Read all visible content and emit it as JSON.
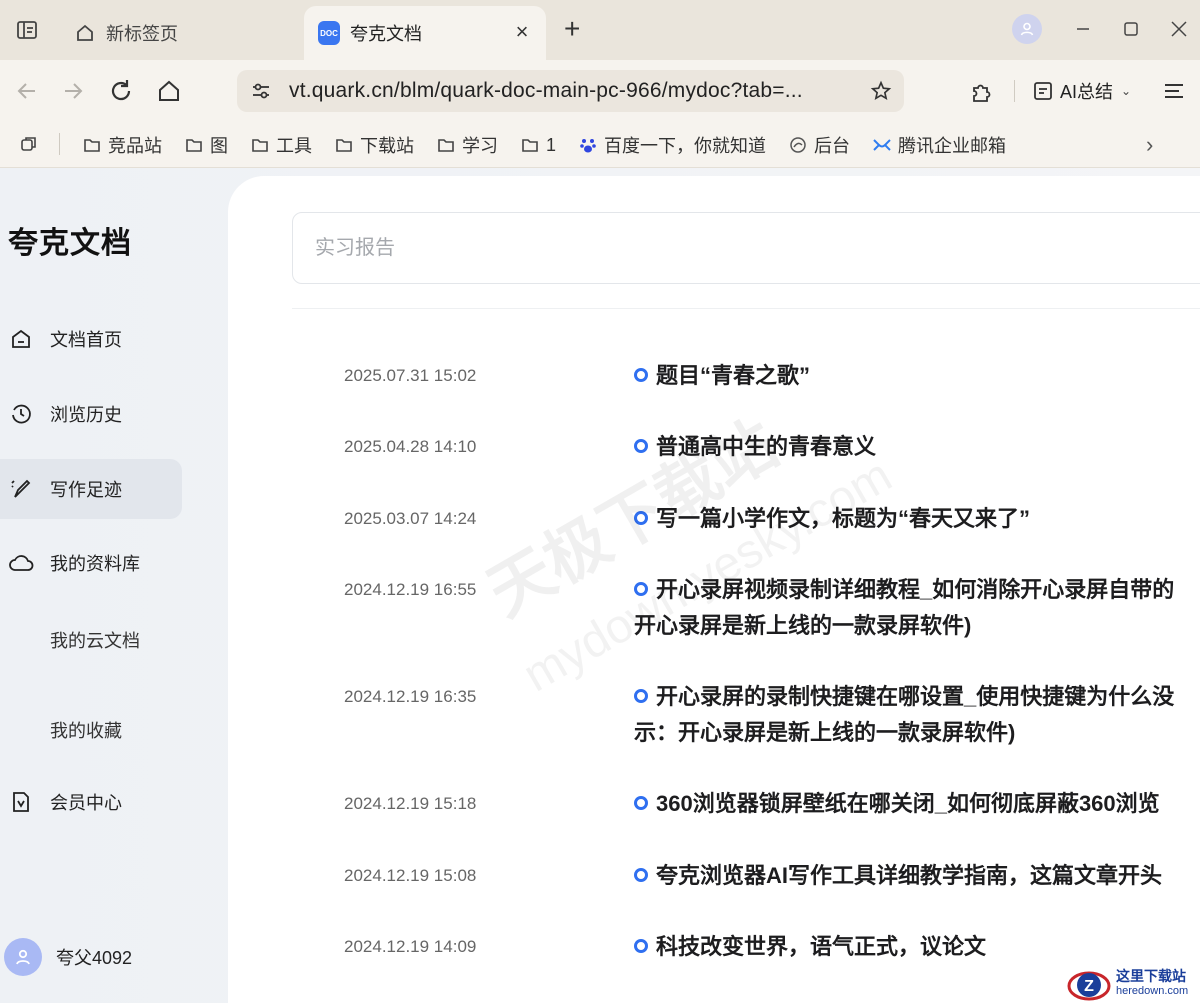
{
  "browser": {
    "tabs": [
      {
        "label": "新标签页",
        "active": false
      },
      {
        "label": "夸克文档",
        "active": true
      }
    ],
    "new_tab": "+",
    "close_tab": "×",
    "url": "vt.quark.cn/blm/quark-doc-main-pc-966/mydoc?tab=...",
    "ai_summary": "AI总结",
    "bookmarks": [
      {
        "label": "竞品站",
        "icon": "folder-icon"
      },
      {
        "label": "图",
        "icon": "folder-icon"
      },
      {
        "label": "工具",
        "icon": "folder-icon"
      },
      {
        "label": "下载站",
        "icon": "folder-icon"
      },
      {
        "label": "学习",
        "icon": "folder-icon"
      },
      {
        "label": "1",
        "icon": "folder-icon"
      },
      {
        "label": "百度一下，你就知道",
        "icon": "baidu-icon"
      },
      {
        "label": "后台",
        "icon": "globe-icon"
      },
      {
        "label": "腾讯企业邮箱",
        "icon": "mail-icon"
      }
    ],
    "bookmarks_more": "›"
  },
  "sidebar": {
    "title": "夸克文档",
    "items": [
      {
        "label": "文档首页",
        "icon": "home-icon"
      },
      {
        "label": "浏览历史",
        "icon": "history-icon"
      },
      {
        "label": "写作足迹",
        "icon": "pen-icon"
      },
      {
        "label": "我的资料库",
        "icon": "cloud-icon"
      }
    ],
    "sub_items": [
      "我的云文档",
      "我的收藏"
    ],
    "member": {
      "label": "会员中心",
      "icon": "member-icon"
    },
    "user": "夸父4092"
  },
  "main": {
    "search_placeholder": "实习报告",
    "records": [
      {
        "time": "2025.07.31 15:02",
        "title": "题目“青春之歌”"
      },
      {
        "time": "2025.04.28 14:10",
        "title": "普通高中生的青春意义"
      },
      {
        "time": "2025.03.07 14:24",
        "title": "写一篇小学作文，标题为“春天又来了”"
      },
      {
        "time": "2024.12.19 16:55",
        "title": "开心录屏视频录制详细教程_如何消除开心录屏自带的",
        "title2": "开心录屏是新上线的一款录屏软件)"
      },
      {
        "time": "2024.12.19 16:35",
        "title": "开心录屏的录制快捷键在哪设置_使用快捷键为什么没",
        "title2": "示：开心录屏是新上线的一款录屏软件)"
      },
      {
        "time": "2024.12.19 15:18",
        "title": "360浏览器锁屏壁纸在哪关闭_如何彻底屏蔽360浏览"
      },
      {
        "time": "2024.12.19 15:08",
        "title": "夸克浏览器AI写作工具详细教学指南，这篇文章开头"
      },
      {
        "time": "2024.12.19 14:09",
        "title": "科技改变世界，语气正式，议论文"
      }
    ]
  },
  "watermark": {
    "line1": "天极下载站",
    "line2": "mydown.yesky.com"
  },
  "corner_logo": {
    "line1": "这里下载站",
    "line2": "heredown.com"
  },
  "colors": {
    "accent": "#2f6ff0",
    "tab_strip": "#eae5dc",
    "active_nav": "#e2e6ec"
  }
}
